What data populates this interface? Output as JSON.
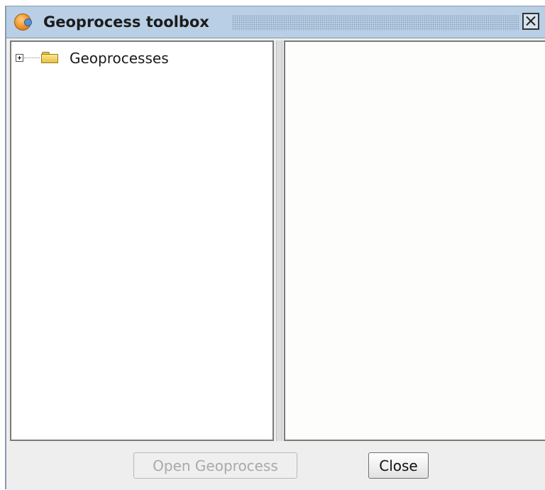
{
  "window": {
    "title": "Geoprocess toolbox",
    "app_icon": "gvsig-globe-icon",
    "close_icon": "close-icon"
  },
  "tree": {
    "root": {
      "label": "Geoprocesses",
      "expanded": false,
      "icon": "folder-icon"
    }
  },
  "buttons": {
    "open_label": "Open Geoprocess",
    "open_enabled": false,
    "close_label": "Close"
  },
  "colors": {
    "titlebar": "#b8cfe5",
    "pane_bg": "#ffffff",
    "disabled_text": "#a9a9a9"
  }
}
